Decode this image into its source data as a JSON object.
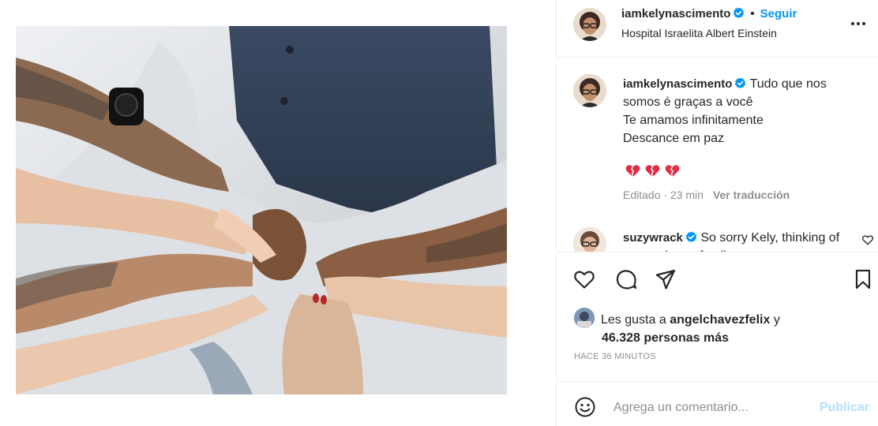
{
  "post": {
    "author": "iamkelynascimento",
    "verified": true,
    "follow_label": "Seguir",
    "separator": "•",
    "location": "Hospital Israelita Albert Einstein",
    "more_icon": "more-horizontal-icon"
  },
  "caption": {
    "username": "iamkelynascimento",
    "line1": "Tudo que nos",
    "line2": "somos é graças a você",
    "line3": "Te amamos infinitamente",
    "line4": "Descance em paz",
    "hearts": [
      "broken-heart-emoji",
      "broken-heart-emoji",
      "broken-heart-emoji"
    ],
    "edited": "Editado · 23 min",
    "translate_label": "Ver traducción"
  },
  "comment": {
    "username": "suzywrack",
    "text": "So sorry Kely, thinking",
    "text_cont": "of you and your family",
    "like_icon": "heart-outline-icon"
  },
  "actions": {
    "like_icon": "heart-outline-icon",
    "comment_icon": "comment-icon",
    "share_icon": "send-icon",
    "save_icon": "bookmark-icon"
  },
  "likes": {
    "prefix": "Les gusta a",
    "user": "angelchavezfelix",
    "and": "y",
    "count": "46.328 personas más"
  },
  "timestamp": "HACE 36 MINUTOS",
  "composer": {
    "placeholder": "Agrega un comentario...",
    "publish_label": "Publicar",
    "emoji_icon": "smiley-icon"
  },
  "colors": {
    "accent": "#0095f6",
    "publish_disabled": "#b2dffc",
    "heart_red": "#ed4956",
    "muted": "#8e8e8e"
  }
}
